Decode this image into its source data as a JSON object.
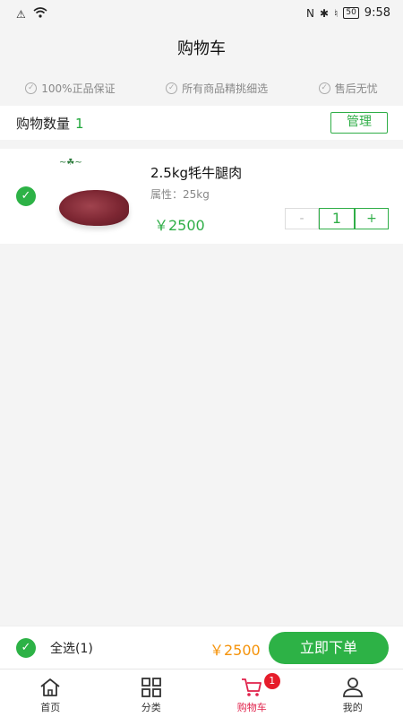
{
  "status_bar": {
    "time": "9:58",
    "battery": "50",
    "icons": [
      "alert-icon",
      "wifi-icon",
      "nfc-icon",
      "bluetooth-icon",
      "mute-icon",
      "battery-icon"
    ]
  },
  "header": {
    "title": "购物车"
  },
  "guarantees": [
    {
      "label": "100%正品保证",
      "icon": "check-circle-icon"
    },
    {
      "label": "所有商品精挑细选",
      "icon": "check-circle-icon"
    },
    {
      "label": "售后无忧",
      "icon": "check-circle-icon"
    }
  ],
  "cart_count": {
    "label": "购物数量",
    "value": "1",
    "manage_label": "管理"
  },
  "items": [
    {
      "title": "2.5kg牦牛腿肉",
      "attribute": "属性：25kg",
      "price": "￥2500",
      "quantity": "1",
      "minus": "-",
      "plus": "+",
      "selected": true
    }
  ],
  "checkout": {
    "select_all_label": "全选(1)",
    "total": "￥2500",
    "order_label": "立即下单"
  },
  "tabbar": {
    "tabs": [
      {
        "label": "首页",
        "icon": "home-icon"
      },
      {
        "label": "分类",
        "icon": "grid-icon"
      },
      {
        "label": "购物车",
        "icon": "cart-icon",
        "badge": "1",
        "active": true
      },
      {
        "label": "我的",
        "icon": "user-icon"
      }
    ]
  },
  "colors": {
    "accent_green": "#2db246",
    "price_orange": "#f5930a",
    "active_red": "#e0214a",
    "badge_red": "#e61c2a"
  }
}
